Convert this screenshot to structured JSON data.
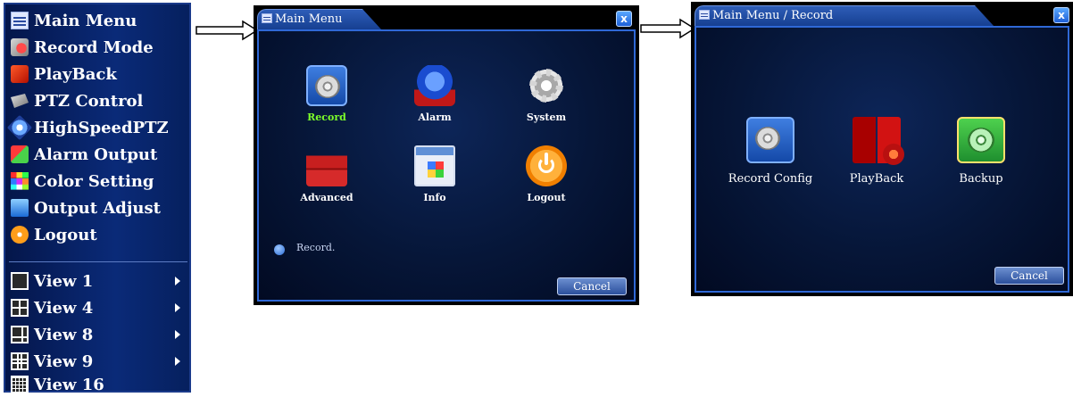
{
  "context_menu": {
    "items": [
      {
        "label": "Main Menu",
        "icon": "main-menu-icon"
      },
      {
        "label": "Record Mode",
        "icon": "record-mode-icon"
      },
      {
        "label": "PlayBack",
        "icon": "playback-icon"
      },
      {
        "label": "PTZ Control",
        "icon": "ptz-camera-icon"
      },
      {
        "label": "HighSpeedPTZ",
        "icon": "highspeed-ptz-icon"
      },
      {
        "label": "Alarm Output",
        "icon": "alarm-output-icon"
      },
      {
        "label": "Color Setting",
        "icon": "color-grid-icon"
      },
      {
        "label": "Output Adjust",
        "icon": "monitor-icon"
      },
      {
        "label": "Logout",
        "icon": "power-icon"
      }
    ],
    "view_items": [
      {
        "label": "View 1",
        "icon": "view-1-icon",
        "has_submenu": true
      },
      {
        "label": "View 4",
        "icon": "view-4-icon",
        "has_submenu": true
      },
      {
        "label": "View 8",
        "icon": "view-8-icon",
        "has_submenu": true
      },
      {
        "label": "View 9",
        "icon": "view-9-icon",
        "has_submenu": true
      },
      {
        "label": "View 16",
        "icon": "view-16-icon",
        "has_submenu": false
      }
    ]
  },
  "main_menu": {
    "title": "Main Menu",
    "close_label": "x",
    "apps": [
      {
        "label": "Record",
        "icon": "record-film-reel-icon",
        "selected": true
      },
      {
        "label": "Alarm",
        "icon": "alarm-siren-icon",
        "selected": false
      },
      {
        "label": "System",
        "icon": "gear-icon",
        "selected": false
      },
      {
        "label": "Advanced",
        "icon": "toolbox-icon",
        "selected": false
      },
      {
        "label": "Info",
        "icon": "info-window-icon",
        "selected": false
      },
      {
        "label": "Logout",
        "icon": "power-icon",
        "selected": false
      }
    ],
    "status_text": "Record.",
    "cancel_label": "Cancel"
  },
  "record_menu": {
    "title": "Main Menu / Record",
    "close_label": "x",
    "apps": [
      {
        "label": "Record Config",
        "icon": "record-film-reel-icon"
      },
      {
        "label": "PlayBack",
        "icon": "playback-icon"
      },
      {
        "label": "Backup",
        "icon": "backup-film-reel-icon"
      }
    ],
    "cancel_label": "Cancel"
  },
  "colors": {
    "menu_background": "#0a2a78",
    "dialog_border": "#2f68d6",
    "selected_label": "#7dff2a"
  }
}
